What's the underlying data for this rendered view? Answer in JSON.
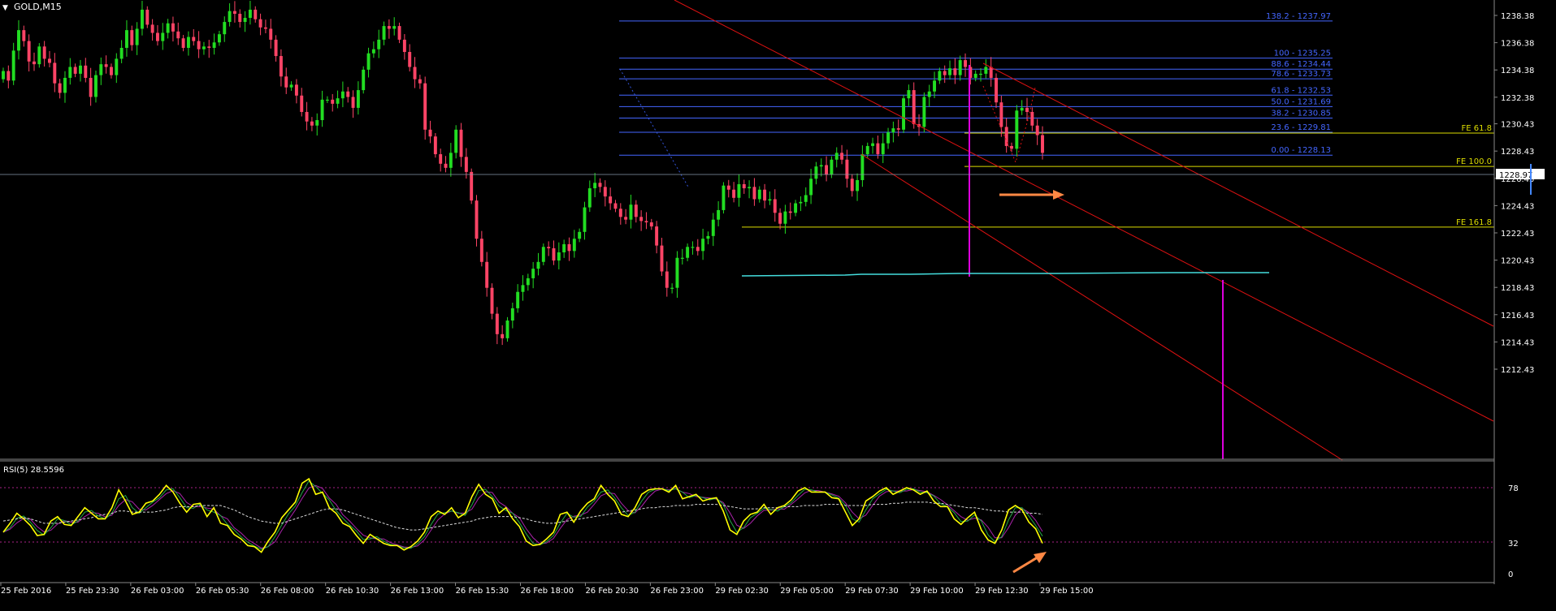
{
  "header": {
    "symbol_label": "GOLD,M15",
    "menu_glyph": "▼"
  },
  "colors": {
    "background": "#000000",
    "bull": "#22dd22",
    "bear": "#ff4466",
    "fib": "#4466ff",
    "fe": "#dddd00",
    "channel": "#dd1111",
    "magenta": "#dd00dd",
    "cyan": "#44dddd",
    "rsi_line": "#ffff00",
    "rsi_ma": "#dddddd",
    "arrow": "#ff8844",
    "axis_text": "#ffffff",
    "frame": "#888888"
  },
  "price_axis": {
    "ticks": [
      "1238.38",
      "1236.38",
      "1234.38",
      "1232.38",
      "1230.43",
      "1228.43",
      "1226.43",
      "1224.43",
      "1222.43",
      "1220.43",
      "1218.43",
      "1216.43",
      "1214.43",
      "1212.43"
    ],
    "current_price": "1228.97"
  },
  "fib_levels": [
    {
      "label": "138.2 - 1237.97",
      "price": 1237.97
    },
    {
      "label": "100 - 1235.25",
      "price": 1235.25
    },
    {
      "label": "88.6 - 1234.44",
      "price": 1234.44
    },
    {
      "label": "78.6 - 1233.73",
      "price": 1233.73
    },
    {
      "label": "61.8 - 1232.53",
      "price": 1232.53
    },
    {
      "label": "50.0 - 1231.69",
      "price": 1231.69
    },
    {
      "label": "38.2 - 1230.85",
      "price": 1230.85
    },
    {
      "label": "23.6 - 1229.81",
      "price": 1229.81
    },
    {
      "label": "0.00 - 1228.13",
      "price": 1228.13
    }
  ],
  "fe_levels": [
    {
      "label": "FE 61.8",
      "price": 1229.75
    },
    {
      "label": "FE 100.0",
      "price": 1227.3
    },
    {
      "label": "FE 161.8",
      "price": 1222.85
    }
  ],
  "rsi": {
    "label": "RSI(5) 28.5596",
    "levels": [
      "78",
      "32",
      "0"
    ],
    "values": [
      38,
      46,
      55,
      50,
      44,
      35,
      36,
      48,
      52,
      45,
      44,
      52,
      60,
      55,
      50,
      50,
      60,
      76,
      66,
      54,
      56,
      64,
      66,
      72,
      80,
      74,
      64,
      56,
      63,
      64,
      52,
      60,
      46,
      44,
      36,
      32,
      26,
      25,
      20,
      30,
      38,
      51,
      58,
      65,
      82,
      86,
      72,
      74,
      60,
      55,
      46,
      43,
      35,
      28,
      36,
      32,
      28,
      26,
      26,
      22,
      25,
      30,
      38,
      52,
      57,
      54,
      60,
      51,
      55,
      70,
      81,
      72,
      68,
      55,
      60,
      50,
      43,
      30,
      26,
      27,
      32,
      38,
      54,
      56,
      47,
      57,
      64,
      68,
      80,
      72,
      66,
      54,
      52,
      60,
      72,
      76,
      77,
      77,
      74,
      80,
      68,
      70,
      72,
      66,
      68,
      69,
      57,
      40,
      36,
      48,
      54,
      56,
      63,
      54,
      60,
      62,
      67,
      75,
      78,
      74,
      74,
      74,
      69,
      68,
      56,
      44,
      50,
      66,
      70,
      75,
      78,
      72,
      75,
      78,
      76,
      72,
      75,
      66,
      61,
      61,
      50,
      45,
      51,
      56,
      40,
      31,
      28,
      40,
      58,
      62,
      58,
      47,
      41,
      28
    ],
    "ma": [
      48,
      49,
      50,
      51,
      50,
      48,
      46,
      46,
      46,
      47,
      48,
      49,
      50,
      51,
      53,
      54,
      55,
      57,
      57,
      56,
      56,
      56,
      56,
      57,
      58,
      60,
      61,
      61,
      61,
      62,
      62,
      62,
      62,
      60,
      58,
      55,
      52,
      50,
      48,
      47,
      46,
      46,
      48,
      50,
      52,
      54,
      56,
      58,
      59,
      59,
      58,
      56,
      54,
      52,
      50,
      48,
      46,
      44,
      42,
      41,
      40,
      40,
      41,
      42,
      43,
      44,
      45,
      46,
      47,
      48,
      50,
      51,
      52,
      52,
      52,
      52,
      51,
      50,
      48,
      47,
      46,
      46,
      47,
      48,
      49,
      50,
      51,
      52,
      53,
      54,
      55,
      56,
      57,
      58,
      59,
      60,
      60,
      61,
      61,
      62,
      62,
      62,
      63,
      63,
      63,
      63,
      62,
      61,
      60,
      59,
      59,
      59,
      60,
      60,
      60,
      61,
      61,
      61,
      62,
      62,
      62,
      63,
      63,
      63,
      62,
      62,
      62,
      62,
      63,
      63,
      63,
      64,
      64,
      65,
      65,
      65,
      65,
      64,
      64,
      63,
      62,
      61,
      60,
      60,
      59,
      58,
      57,
      57,
      56,
      56,
      56,
      55,
      55,
      54
    ]
  },
  "x_axis": {
    "labels": [
      "25 Feb 2016",
      "25 Feb 23:30",
      "26 Feb 03:00",
      "26 Feb 05:30",
      "26 Feb 08:00",
      "26 Feb 10:30",
      "26 Feb 13:00",
      "26 Feb 15:30",
      "26 Feb 18:00",
      "26 Feb 20:30",
      "26 Feb 23:00",
      "29 Feb 02:30",
      "29 Feb 05:00",
      "29 Feb 07:30",
      "29 Feb 10:00",
      "29 Feb 12:30",
      "29 Feb 15:00"
    ]
  },
  "chart_data": {
    "type": "candlestick",
    "symbol": "GOLD",
    "timeframe": "M15",
    "ylim": [
      1212.0,
      1239.2
    ],
    "current_price": 1228.97,
    "closes": [
      1234.3,
      1233.6,
      1235.8,
      1237.3,
      1236.5,
      1235.0,
      1234.8,
      1236.1,
      1235.2,
      1234.9,
      1233.4,
      1232.7,
      1233.8,
      1234.6,
      1234.1,
      1234.7,
      1233.8,
      1232.4,
      1234.0,
      1234.8,
      1234.6,
      1234.0,
      1235.2,
      1236.0,
      1237.3,
      1236.2,
      1237.4,
      1238.8,
      1237.7,
      1237.1,
      1236.5,
      1237.1,
      1237.8,
      1237.2,
      1236.7,
      1236.0,
      1236.8,
      1236.5,
      1235.9,
      1236.1,
      1236.0,
      1236.4,
      1237.0,
      1237.9,
      1238.7,
      1238.5,
      1237.9,
      1238.2,
      1238.8,
      1238.1,
      1237.5,
      1237.4,
      1236.6,
      1235.4,
      1233.9,
      1233.1,
      1233.3,
      1232.5,
      1231.3,
      1230.6,
      1230.3,
      1230.7,
      1232.2,
      1232.2,
      1231.9,
      1232.3,
      1232.8,
      1232.4,
      1231.6,
      1232.9,
      1234.4,
      1235.6,
      1235.9,
      1236.6,
      1237.6,
      1237.4,
      1237.6,
      1236.6,
      1235.7,
      1234.6,
      1233.7,
      1233.4,
      1230.0,
      1229.5,
      1228.2,
      1227.5,
      1227.2,
      1228.3,
      1230.0,
      1228.0,
      1226.9,
      1224.8,
      1222.0,
      1220.3,
      1218.4,
      1216.5,
      1215.0,
      1214.7,
      1216.0,
      1216.9,
      1218.1,
      1218.6,
      1219.1,
      1219.8,
      1220.3,
      1221.4,
      1221.3,
      1220.4,
      1221.0,
      1221.6,
      1221.1,
      1222.0,
      1222.5,
      1224.3,
      1225.7,
      1226.1,
      1225.8,
      1225.1,
      1224.6,
      1224.2,
      1223.6,
      1223.4,
      1224.5,
      1223.6,
      1223.3,
      1223.2,
      1222.9,
      1221.5,
      1219.6,
      1218.4,
      1218.4,
      1220.6,
      1220.6,
      1221.4,
      1221.4,
      1221.1,
      1222.0,
      1222.2,
      1223.4,
      1224.1,
      1225.9,
      1225.6,
      1225.0,
      1226.0,
      1225.7,
      1225.8,
      1224.9,
      1225.6,
      1224.8,
      1224.9,
      1223.9,
      1223.1,
      1224.0,
      1223.9,
      1224.6,
      1224.7,
      1225.2,
      1226.4,
      1227.3,
      1227.4,
      1226.7,
      1227.8,
      1228.3,
      1227.8,
      1226.4,
      1225.5,
      1226.3,
      1228.2,
      1228.8,
      1229.0,
      1228.2,
      1229.0,
      1229.8,
      1230.1,
      1230.0,
      1232.3,
      1232.9,
      1230.4,
      1230.2,
      1232.4,
      1232.8,
      1233.6,
      1234.3,
      1234.0,
      1234.5,
      1234.0,
      1235.1,
      1234.6,
      1233.8,
      1234.1,
      1234.1,
      1234.6,
      1233.8,
      1232.0,
      1230.2,
      1228.8,
      1228.6,
      1231.4,
      1231.6,
      1231.3,
      1230.3,
      1229.6,
      1228.3
    ],
    "fib_retracement": [
      {
        "level": "138.2",
        "price": 1237.97
      },
      {
        "level": "100",
        "price": 1235.25
      },
      {
        "level": "88.6",
        "price": 1234.44
      },
      {
        "level": "78.6",
        "price": 1233.73
      },
      {
        "level": "61.8",
        "price": 1232.53
      },
      {
        "level": "50.0",
        "price": 1231.69
      },
      {
        "level": "38.2",
        "price": 1230.85
      },
      {
        "level": "23.6",
        "price": 1229.81
      },
      {
        "level": "0.00",
        "price": 1228.13
      }
    ],
    "fib_expansion": [
      {
        "level": "61.8",
        "price": 1229.75
      },
      {
        "level": "100.0",
        "price": 1227.3
      },
      {
        "level": "161.8",
        "price": 1222.85
      }
    ],
    "rsi_period": 5,
    "rsi_value": 28.5596,
    "rsi_levels": [
      78,
      32
    ]
  }
}
